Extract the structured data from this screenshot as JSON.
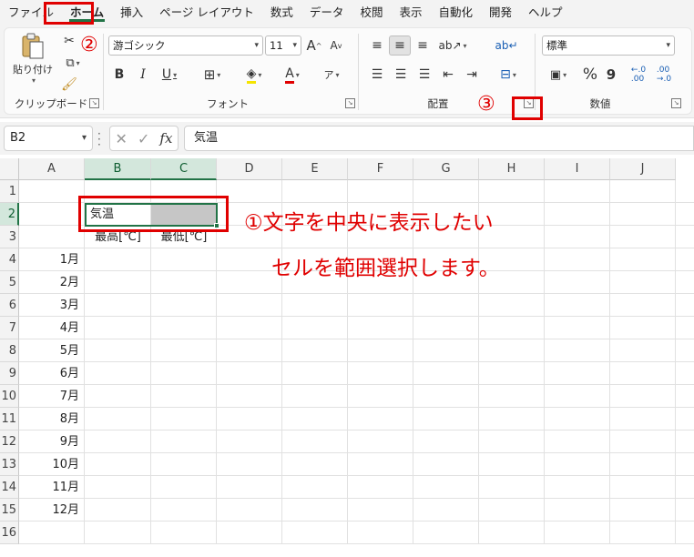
{
  "menu": {
    "items": [
      "ファイル",
      "ホーム",
      "挿入",
      "ページ レイアウト",
      "数式",
      "データ",
      "校閲",
      "表示",
      "自動化",
      "開発",
      "ヘルプ"
    ],
    "active_index": 1
  },
  "ribbon": {
    "clipboard": {
      "paste_label": "貼り付け",
      "group_label": "クリップボード"
    },
    "font": {
      "font_name": "游ゴシック",
      "font_size": "11",
      "group_label": "フォント",
      "bold": "B",
      "italic": "I",
      "underline": "U",
      "font_color_glyph": "A",
      "grow": "A",
      "shrink": "A"
    },
    "alignment": {
      "group_label": "配置"
    },
    "number": {
      "format": "標準",
      "group_label": "数値",
      "percent": "%",
      "comma": "9"
    }
  },
  "formula_bar": {
    "name_box": "B2",
    "fx": "fx",
    "content": "気温"
  },
  "sheet": {
    "columns": [
      "A",
      "B",
      "C",
      "D",
      "E",
      "F",
      "G",
      "H",
      "I",
      "J"
    ],
    "rows": [
      "1",
      "2",
      "3",
      "4",
      "5",
      "6",
      "7",
      "8",
      "9",
      "10",
      "11",
      "12",
      "13",
      "14",
      "15",
      "16"
    ],
    "cells": {
      "B2": "気温",
      "B3": "最高[℃]",
      "C3": "最低[℃]",
      "months": [
        "1月",
        "2月",
        "3月",
        "4月",
        "5月",
        "6月",
        "7月",
        "8月",
        "9月",
        "10月",
        "11月",
        "12月"
      ]
    }
  },
  "annotations": {
    "step1_line1": "①文字を中央に表示したい",
    "step1_line2": "セルを範囲選択します。",
    "step2": "②",
    "step3": "③"
  },
  "colors": {
    "accent": "#217346",
    "annotation": "#e00000",
    "selection_fill": "#c6c6c6"
  }
}
